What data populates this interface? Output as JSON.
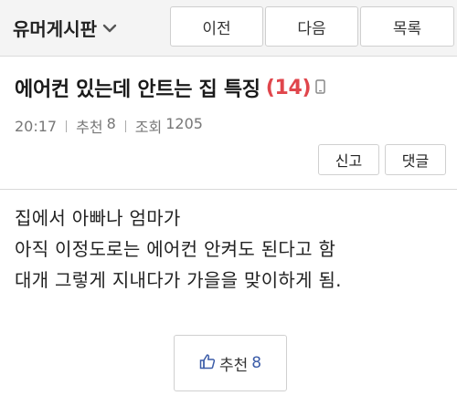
{
  "header": {
    "board_title": "유머게시판",
    "prev_label": "이전",
    "next_label": "다음",
    "list_label": "목록"
  },
  "post": {
    "title": "에어컨 있는데 안트는 집 특징",
    "comment_count": "(14)",
    "time": "20:17",
    "recommend_label": "추천",
    "recommend_count": "8",
    "views_label": "조회",
    "views_count": "1205",
    "report_label": "신고",
    "reply_label": "댓글",
    "body_lines": [
      "집에서 아빠나 엄마가",
      "아직 이정도로는 에어컨 안켜도 된다고 함",
      "대개 그렇게 지내다가 가을을 맞이하게 됨."
    ]
  },
  "recommend_button": {
    "label": "추천",
    "count": "8"
  },
  "colors": {
    "comment_count": "#e0464c",
    "recommend_count": "#3b5ca8",
    "topbar_bg": "#f4f4f4"
  },
  "icons": [
    "chevron-down-icon",
    "mobile-icon",
    "thumbs-up-icon"
  ]
}
